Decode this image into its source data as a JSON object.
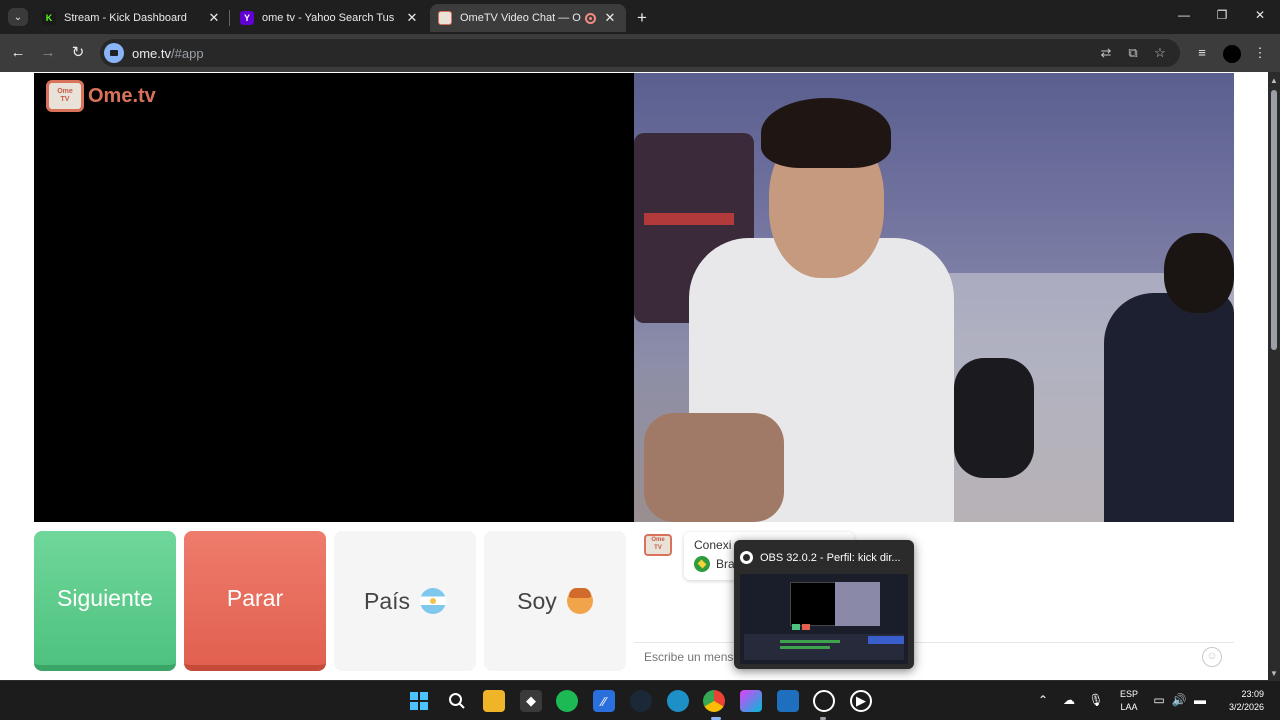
{
  "browser": {
    "tabs": [
      {
        "title": "Stream - Kick Dashboard",
        "icon": "kick-icon",
        "active": false
      },
      {
        "title": "ome tv - Yahoo Search Tus resu",
        "icon": "yahoo-icon",
        "active": false
      },
      {
        "title": "OmeTV Video Chat — Ome",
        "icon": "ometv-icon",
        "active": true,
        "recording": true
      }
    ],
    "close_glyph": "✕",
    "new_tab_glyph": "+",
    "url_host": "ome.tv",
    "url_path": "/#app"
  },
  "page": {
    "logo_tv_line1": "Ome",
    "logo_tv_line2": "TV",
    "logo_text": "Ome.tv",
    "buttons": {
      "next": "Siguiente",
      "stop": "Parar",
      "country": "País",
      "gender": "Soy"
    },
    "chat": {
      "message_line1": "Conexi",
      "message_line2": "Bra",
      "input_placeholder": "Escribe un mensaje",
      "smiley": "☺"
    }
  },
  "obs_popup": {
    "title": "OBS 32.0.2 - Perfil: kick dir..."
  },
  "taskbar": {
    "lang_line1": "ESP",
    "lang_line2": "LAA",
    "time": "23:09",
    "date": "3/2/2026"
  },
  "colors": {
    "next_button": "#4fc27f",
    "stop_button": "#e2604f",
    "brand": "#d9725a"
  }
}
